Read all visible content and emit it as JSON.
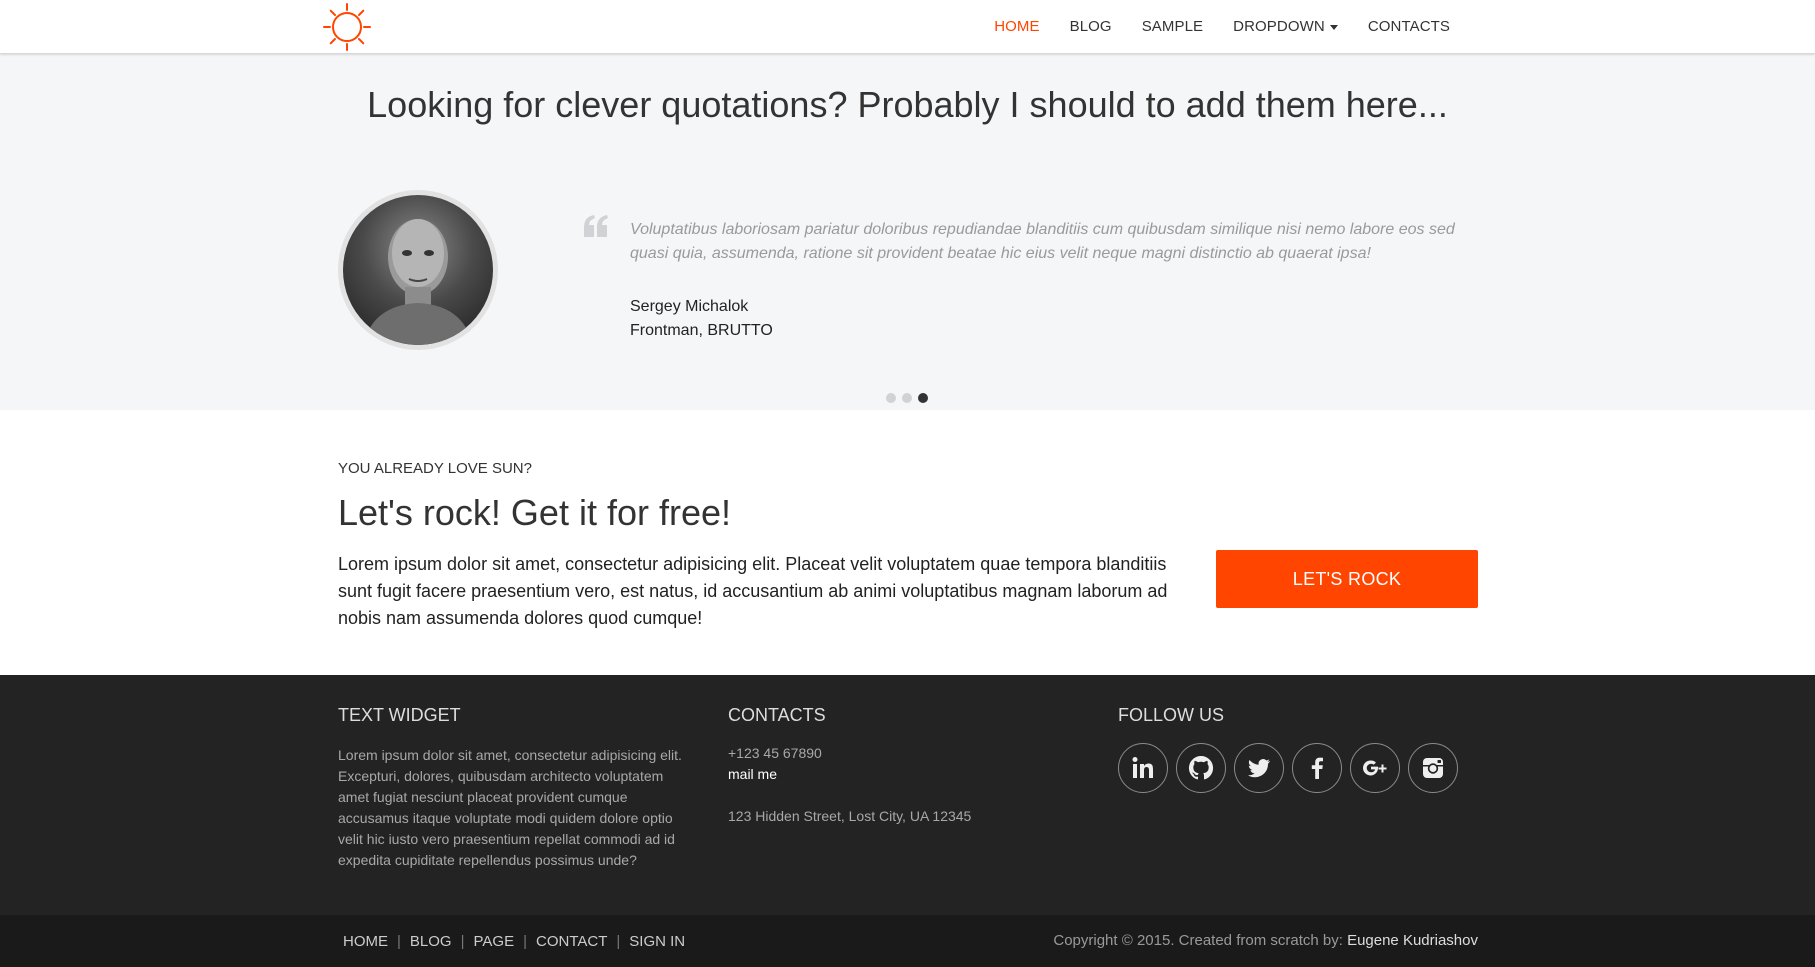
{
  "nav": {
    "items": [
      {
        "label": "HOME",
        "active": true
      },
      {
        "label": "BLOG",
        "active": false
      },
      {
        "label": "SAMPLE",
        "active": false
      },
      {
        "label": "DROPDOWN",
        "active": false,
        "has_caret": true
      },
      {
        "label": "CONTACTS",
        "active": false
      }
    ]
  },
  "logo": {
    "icon": "sun-icon",
    "color": "#ff4500"
  },
  "testimonials": {
    "heading": "Looking for clever quotations? Probably I should to add them here...",
    "quote": "Voluptatibus laboriosam pariatur doloribus repudiandae blanditiis cum quibusdam similique nisi nemo labore eos sed quasi quia, assumenda, ratione sit provident beatae hic eius velit neque magni distinctio ab quaerat ipsa!",
    "author": "Sergey Michalok",
    "role": "Frontman, BRUTTO",
    "slides_total": 3,
    "active_slide": 3
  },
  "cta": {
    "eyebrow": "YOU ALREADY LOVE SUN?",
    "title": "Let's rock! Get it for free!",
    "body": "Lorem ipsum dolor sit amet, consectetur adipisicing elit. Placeat velit voluptatem quae tempora blanditiis sunt fugit facere praesentium vero, est natus, id accusantium ab animi voluptatibus magnam laborum ad nobis nam assumenda dolores quod cumque!",
    "button_label": "LET'S ROCK",
    "accent": "#ff4500"
  },
  "footer": {
    "text_widget": {
      "title": "TEXT WIDGET",
      "body": "Lorem ipsum dolor sit amet, consectetur adipisicing elit. Excepturi, dolores, quibusdam architecto voluptatem amet fugiat nesciunt placeat provident cumque accusamus itaque voluptate modi quidem dolore optio velit hic iusto vero praesentium repellat commodi ad id expedita cupiditate repellendus possimus unde?"
    },
    "contacts": {
      "title": "CONTACTS",
      "phone": "+123 45 67890",
      "mail_label": "mail me",
      "address": "123 Hidden Street, Lost City, UA 12345"
    },
    "follow": {
      "title": "FOLLOW US",
      "networks": [
        "linkedin-icon",
        "github-icon",
        "twitter-icon",
        "facebook-icon",
        "google-plus-icon",
        "instagram-icon"
      ]
    }
  },
  "bottombar": {
    "links": [
      "HOME",
      "BLOG",
      "PAGE",
      "CONTACT",
      "SIGN IN"
    ],
    "copyright": "Copyright © 2015. Created from scratch by:",
    "author": "Eugene Kudriashov"
  }
}
